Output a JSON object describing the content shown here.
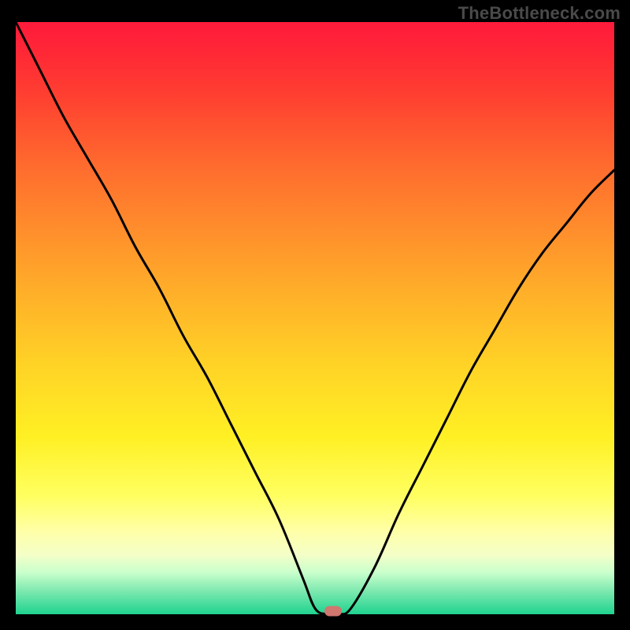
{
  "watermark": "TheBottleneck.com",
  "colors": {
    "page_bg": "#000000",
    "curve": "#000000",
    "marker": "#d0776f",
    "gradient_top": "#ff1a3c",
    "gradient_bottom": "#1fd38f"
  },
  "chart_data": {
    "type": "line",
    "title": "",
    "xlabel": "",
    "ylabel": "",
    "xlim": [
      0,
      100
    ],
    "ylim": [
      0,
      100
    ],
    "grid": false,
    "series": [
      {
        "name": "curve",
        "x": [
          0,
          4,
          8,
          12,
          16,
          20,
          24,
          28,
          32,
          36,
          40,
          44,
          48,
          50,
          52,
          54,
          56,
          60,
          64,
          68,
          72,
          76,
          80,
          84,
          88,
          92,
          96,
          100
        ],
        "y": [
          100,
          92,
          84,
          77,
          70,
          62,
          55,
          47,
          40,
          32,
          24,
          16,
          6,
          1,
          0,
          0,
          1,
          8,
          17,
          25,
          33,
          41,
          48,
          55,
          61,
          66,
          71,
          75
        ]
      }
    ],
    "marker": {
      "x": 53,
      "y": 0.5
    },
    "annotations": [
      {
        "text": "TheBottleneck.com",
        "pos": "top-right"
      }
    ]
  }
}
